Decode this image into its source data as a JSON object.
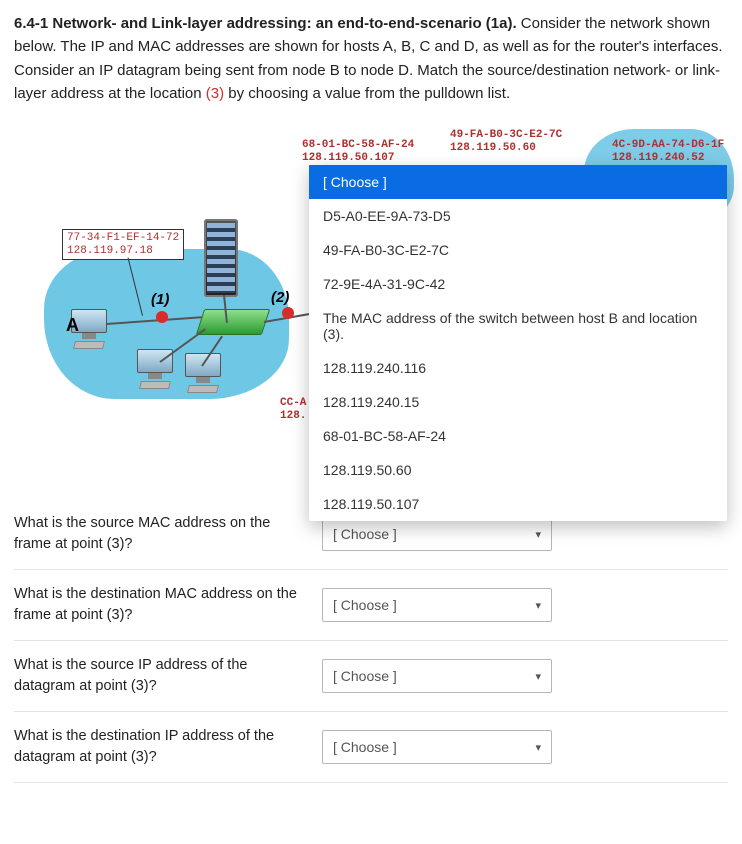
{
  "heading_bold": "6.4-1 Network- and Link-layer addressing: an end-to-end-scenario (1a).",
  "heading_rest_1": " Consider the network shown below. The IP and MAC addresses are shown for hosts A, B, C and D, as well as for the router's interfaces. Consider an IP datagram being sent from node B to node D.  Match the source/destination network- or link-layer address at the location ",
  "heading_red": "(3)",
  "heading_rest_2": " by choosing a value from the pulldown list.",
  "diagram": {
    "hostA_label": "A",
    "addr_hostA_mac": "77-34-F1-EF-14-72",
    "addr_hostA_ip": "128.119.97.18",
    "addr_routerL_mac": "68-01-BC-58-AF-24",
    "addr_routerL_ip": "128.119.50.107",
    "addr_hostB_mac": "49-FA-B0-3C-E2-7C",
    "addr_hostB_ip": "128.119.50.60",
    "addr_routerR_mac": "4C-9D-AA-74-D6-1F",
    "addr_routerR_ip": "128.119.240.52",
    "pt1": "(1)",
    "pt2": "(2)",
    "cc_hint_mac": "CC-A",
    "cc_hint_ip": "128."
  },
  "dropdown": {
    "selected_label": "[ Choose ]",
    "options": [
      "D5-A0-EE-9A-73-D5",
      "49-FA-B0-3C-E2-7C",
      "72-9E-4A-31-9C-42",
      "The MAC address of the switch between host B and location (3).",
      "128.119.240.116",
      "128.119.240.15",
      "68-01-BC-58-AF-24",
      "128.119.50.60",
      "128.119.50.107"
    ]
  },
  "questions": {
    "q1": "What is the source MAC address on the frame at point (3)?",
    "q2": "What is the destination MAC address on the frame at point (3)?",
    "q3": "What is the source IP address of the datagram at point (3)?",
    "q4": "What is the destination IP address of the datagram at point (3)?",
    "placeholder": "[ Choose ]"
  }
}
